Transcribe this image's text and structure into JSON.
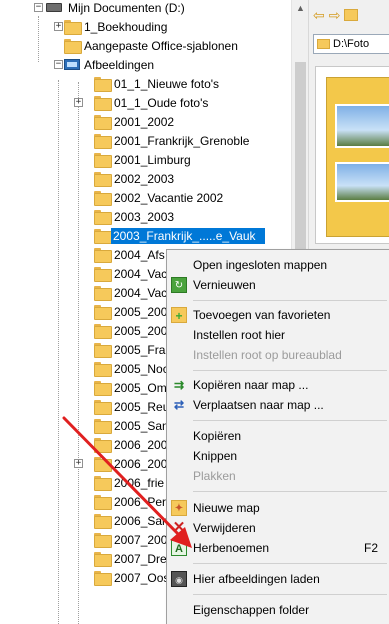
{
  "tree": {
    "root": "Mijn Documenten (D:)",
    "items": [
      "1_Boekhouding",
      "Aangepaste Office-sjablonen",
      "Afbeeldingen",
      "01_1_Nieuwe foto's",
      "01_1_Oude foto's",
      "2001_2002",
      "2001_Frankrijk_Grenoble",
      "2001_Limburg",
      "2002_2003",
      "2002_Vacantie 2002",
      "2003_2003",
      "2003_Frankrijk_.....e_Vauk",
      "2004_Afs",
      "2004_Vac",
      "2004_Vac",
      "2005_200",
      "2005_200",
      "2005_Fra",
      "2005_Noc",
      "2005_Om",
      "2005_Reu",
      "2005_San",
      "2006_200",
      "2006_200",
      "2006_frie",
      "2006_Per",
      "2006_San",
      "2007_200",
      "2007_Dre",
      "2007_Oos"
    ]
  },
  "toolbar": {
    "back_icon": "arrow-left-icon",
    "forward_icon": "arrow-right-icon"
  },
  "path": "D:\\Foto",
  "menu": {
    "items": [
      {
        "label": "Open ingesloten mappen",
        "icon": "",
        "enabled": true
      },
      {
        "label": "Vernieuwen",
        "icon": "refresh-icon",
        "enabled": true
      },
      {
        "label": "Toevoegen van favorieten",
        "icon": "add-favorite-icon",
        "enabled": true
      },
      {
        "label": "Instellen root hier",
        "icon": "",
        "enabled": true
      },
      {
        "label": "Instellen root op bureaublad",
        "icon": "",
        "enabled": false
      },
      {
        "label": "Kopiëren naar map ...",
        "icon": "copy-to-folder-icon",
        "enabled": true
      },
      {
        "label": "Verplaatsen naar map ...",
        "icon": "move-to-folder-icon",
        "enabled": true
      },
      {
        "label": "Kopiëren",
        "icon": "",
        "enabled": true
      },
      {
        "label": "Knippen",
        "icon": "",
        "enabled": true
      },
      {
        "label": "Plakken",
        "icon": "",
        "enabled": false
      },
      {
        "label": "Nieuwe map",
        "icon": "new-folder-icon",
        "enabled": true
      },
      {
        "label": "Verwijderen",
        "icon": "delete-icon",
        "enabled": true
      },
      {
        "label": "Herbenoemen",
        "icon": "rename-icon",
        "enabled": true,
        "shortcut": "F2"
      },
      {
        "label": "Hier afbeeldingen laden",
        "icon": "load-images-icon",
        "enabled": true
      },
      {
        "label": "Eigenschappen folder",
        "icon": "",
        "enabled": true
      }
    ]
  },
  "colors": {
    "selection": "#0078d7",
    "folder": "#f6c95b",
    "annotation_arrow": "#e02020"
  }
}
